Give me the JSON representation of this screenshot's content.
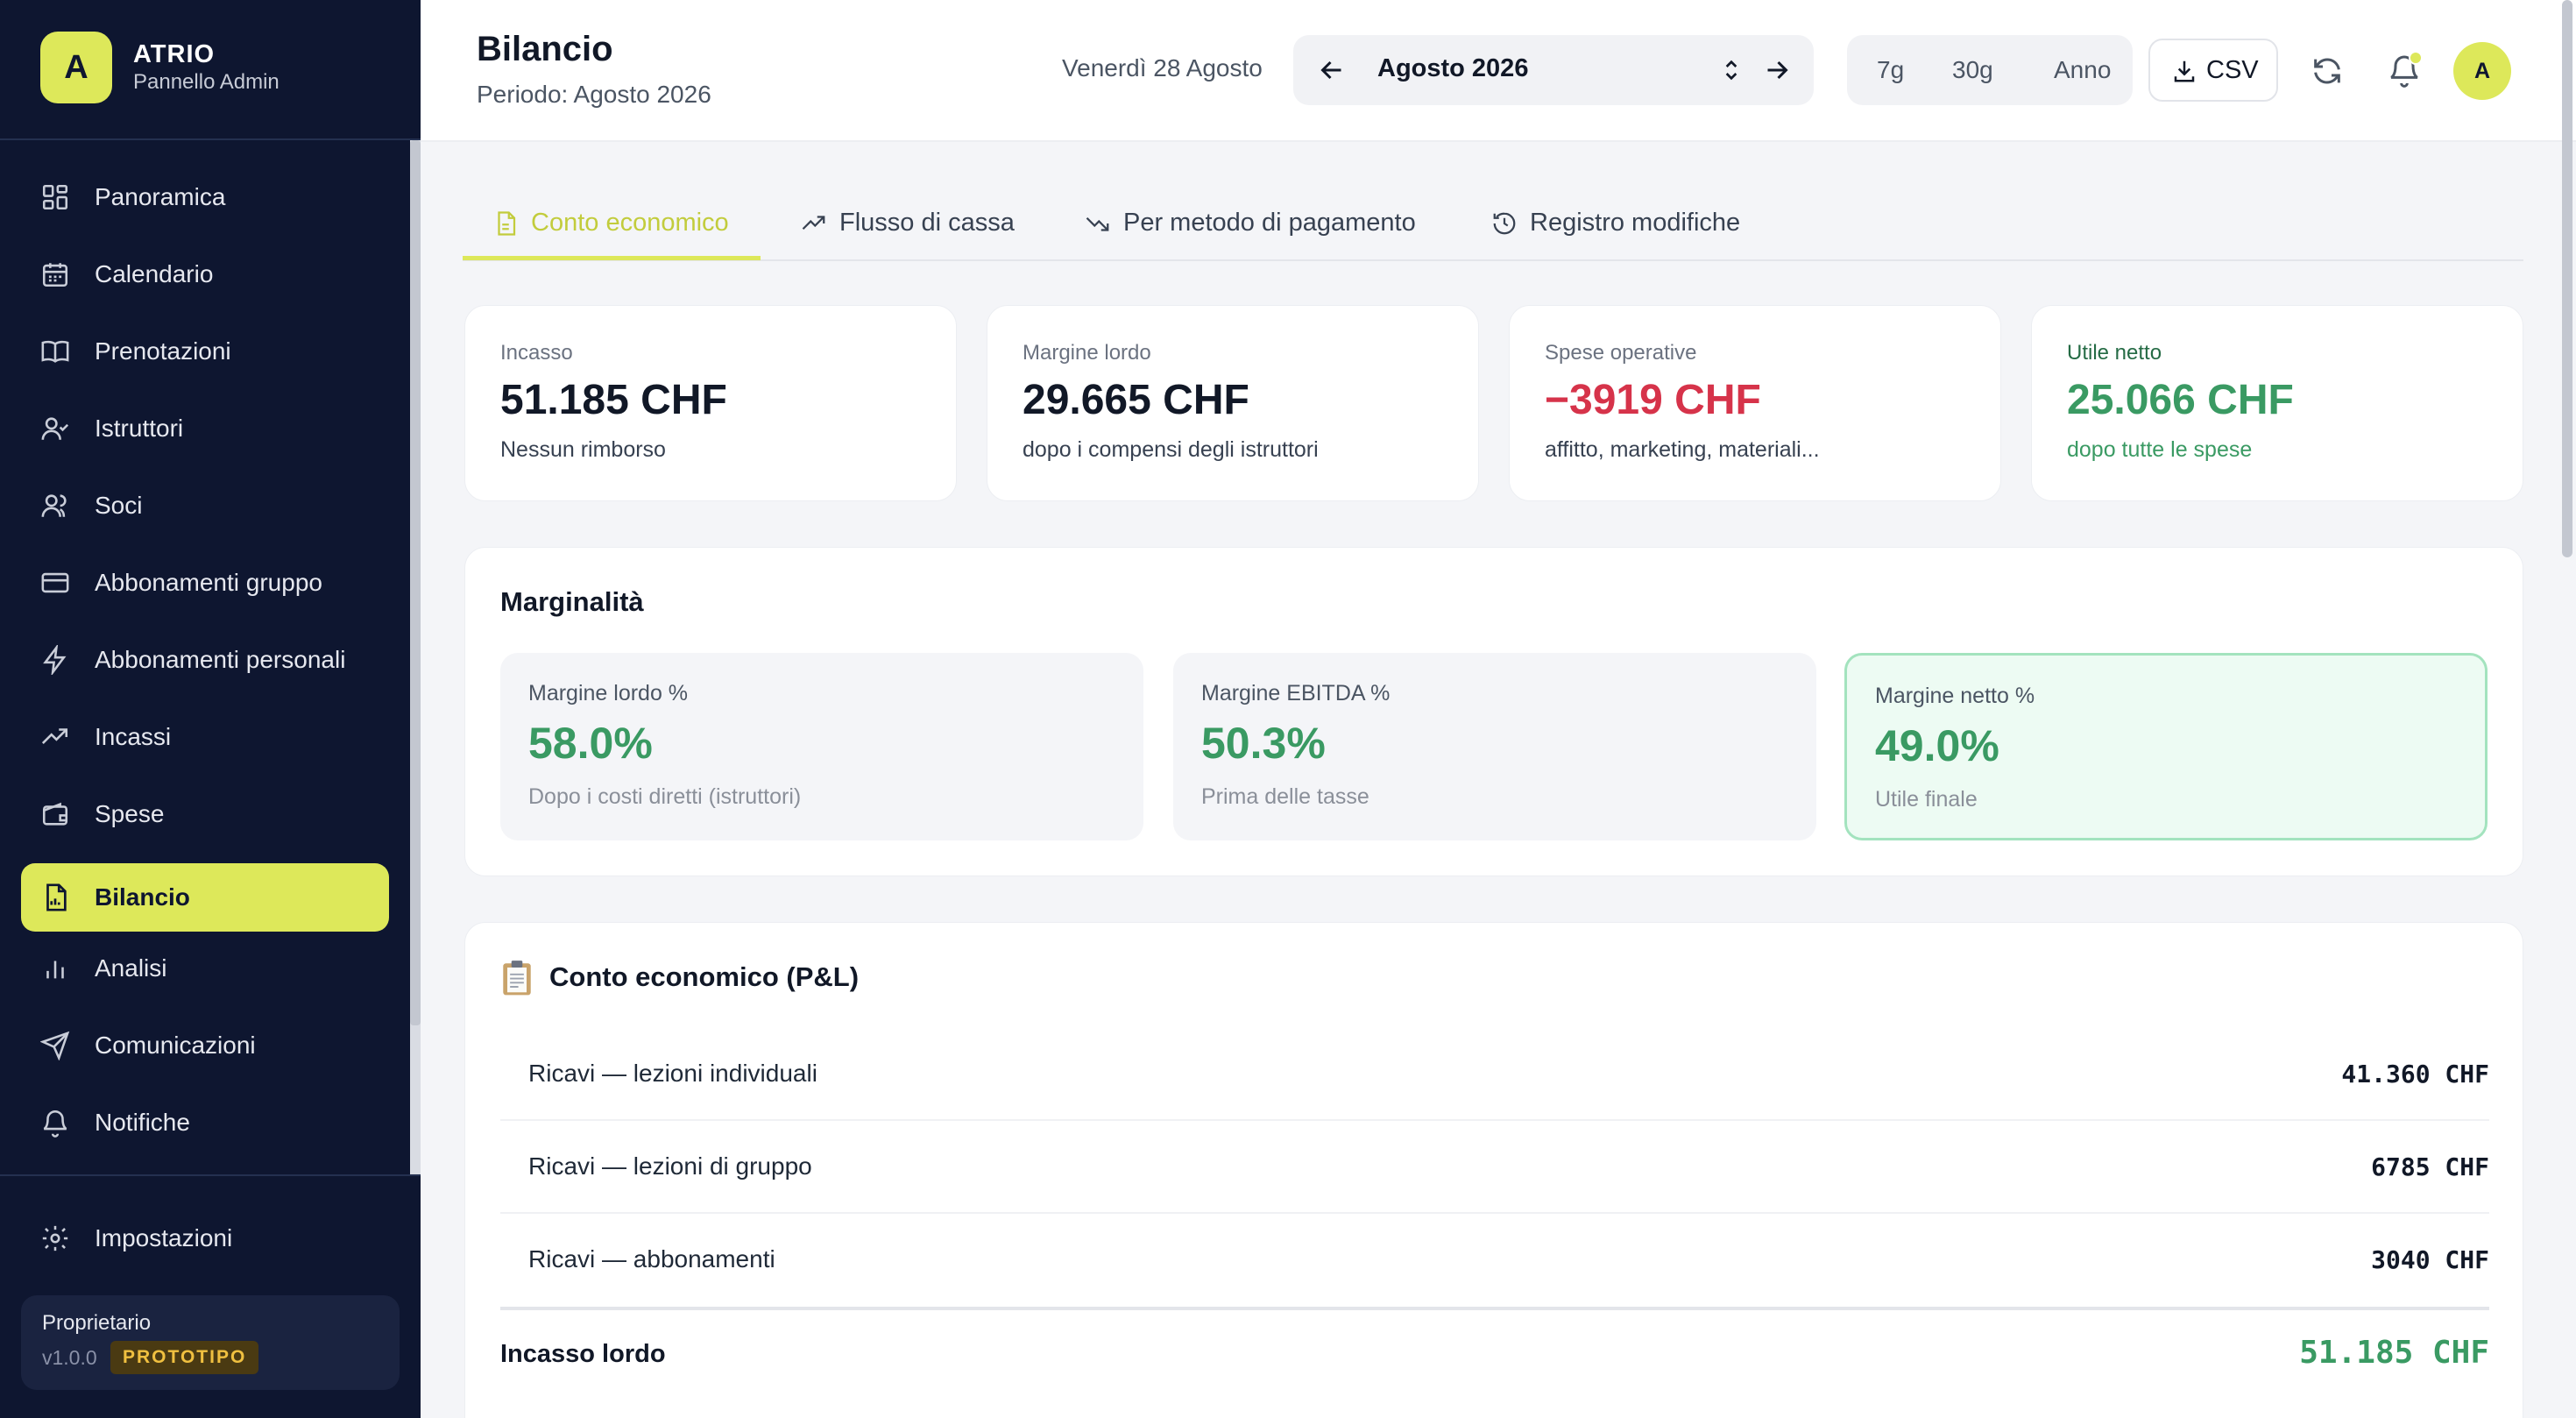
{
  "brand": {
    "logo_letter": "A",
    "name": "ATRIO",
    "subtitle": "Pannello Admin"
  },
  "sidebar": {
    "items": [
      {
        "label": "Panoramica",
        "icon": "grid-icon"
      },
      {
        "label": "Calendario",
        "icon": "calendar-icon"
      },
      {
        "label": "Prenotazioni",
        "icon": "book-icon"
      },
      {
        "label": "Istruttori",
        "icon": "user-check-icon"
      },
      {
        "label": "Soci",
        "icon": "users-icon"
      },
      {
        "label": "Abbonamenti gruppo",
        "icon": "credit-card-icon"
      },
      {
        "label": "Abbonamenti personali",
        "icon": "lightning-icon"
      },
      {
        "label": "Incassi",
        "icon": "trend-up-icon"
      },
      {
        "label": "Spese",
        "icon": "wallet-icon"
      },
      {
        "label": "Bilancio",
        "icon": "report-icon",
        "active": true
      },
      {
        "label": "Analisi",
        "icon": "bar-chart-icon"
      },
      {
        "label": "Comunicazioni",
        "icon": "send-icon"
      },
      {
        "label": "Notifiche",
        "icon": "bell-icon"
      }
    ],
    "settings_label": "Impostazioni",
    "owner": {
      "role": "Proprietario",
      "version": "v1.0.0",
      "badge": "PROTOTIPO"
    }
  },
  "header": {
    "title": "Bilancio",
    "subtitle": "Periodo: Agosto 2026",
    "date_label": "Venerdì 28 Agosto",
    "month_label": "Agosto 2026",
    "ranges": [
      "7g",
      "30g",
      "Anno"
    ],
    "csv_label": "CSV",
    "avatar_letter": "A"
  },
  "tabs": [
    {
      "label": "Conto economico",
      "active": true
    },
    {
      "label": "Flusso di cassa"
    },
    {
      "label": "Per metodo di pagamento"
    },
    {
      "label": "Registro modifiche"
    }
  ],
  "kpis": [
    {
      "label": "Incasso",
      "value": "51.185 CHF",
      "note": "Nessun rimborso"
    },
    {
      "label": "Margine lordo",
      "value": "29.665 CHF",
      "note": "dopo i compensi degli istruttori"
    },
    {
      "label": "Spese operative",
      "value": "−3919 CHF",
      "note": "affitto, marketing, materiali..."
    },
    {
      "label": "Utile netto",
      "value": "25.066 CHF",
      "note": "dopo tutte le spese"
    }
  ],
  "marginalita": {
    "title": "Marginalità",
    "boxes": [
      {
        "label": "Margine lordo %",
        "value": "58.0%",
        "note": "Dopo i costi diretti (istruttori)"
      },
      {
        "label": "Margine EBITDA %",
        "value": "50.3%",
        "note": "Prima delle tasse"
      },
      {
        "label": "Margine netto %",
        "value": "49.0%",
        "note": "Utile finale"
      }
    ]
  },
  "pl": {
    "title": "Conto economico (P&L)",
    "rows": [
      {
        "label": "Ricavi — lezioni individuali",
        "value": "41.360 CHF"
      },
      {
        "label": "Ricavi — lezioni di gruppo",
        "value": "6785 CHF"
      },
      {
        "label": "Ricavi — abbonamenti",
        "value": "3040 CHF"
      }
    ],
    "total": {
      "label": "Incasso lordo",
      "value": "51.185 CHF"
    }
  },
  "colors": {
    "accent": "#dde85a",
    "sidebar_bg": "#0e1630",
    "positive": "#3a9a63",
    "negative": "#d6334a"
  }
}
